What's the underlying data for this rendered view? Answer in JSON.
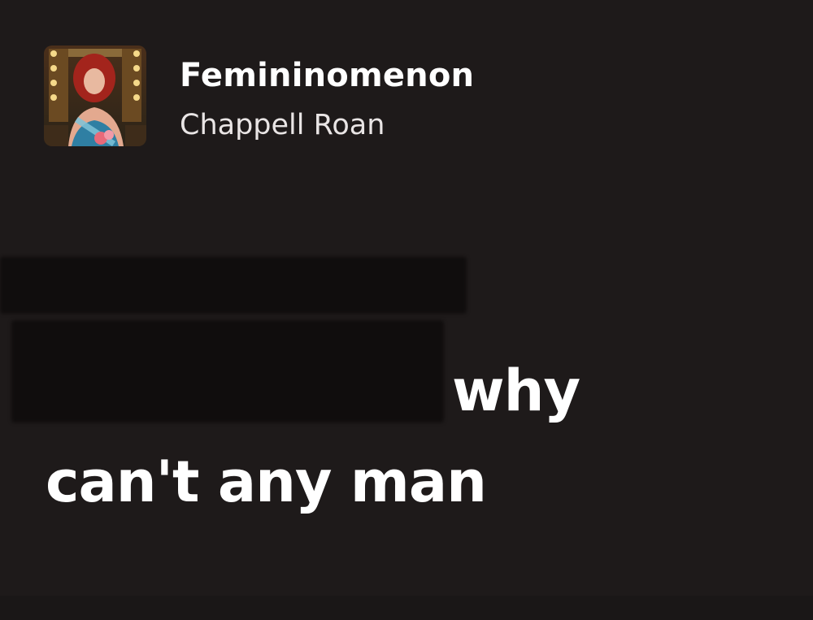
{
  "track": {
    "title": "Femininomenon",
    "artist": "Chappell Roan",
    "album_art": "album-cover-image"
  },
  "lyrics": {
    "current_tail": "why",
    "next_line": "can't any man"
  },
  "colors": {
    "background": "#1e1a1a",
    "text_primary": "#ffffff",
    "text_secondary": "#e9e5e5"
  }
}
